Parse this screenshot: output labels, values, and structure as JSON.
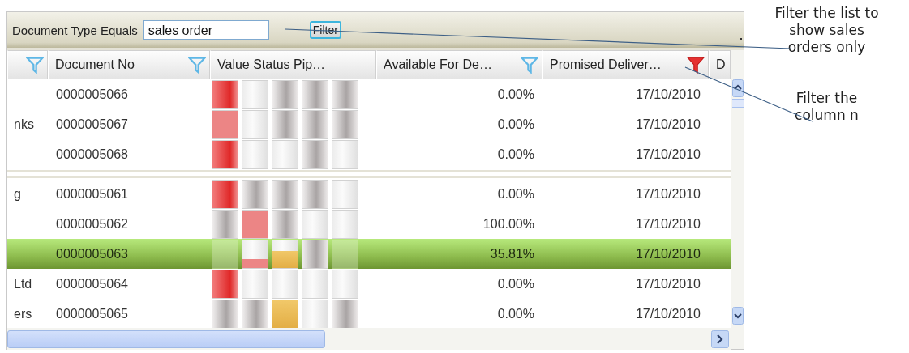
{
  "toolbar": {
    "label": "Document Type Equals",
    "field_value": "sales order",
    "button": "Filter"
  },
  "columns": [
    {
      "has_filter": true,
      "filter_active": false
    },
    {
      "label": "Document No",
      "has_filter": true,
      "filter_active": false
    },
    {
      "label": "Value Status Pip…",
      "has_filter": false
    },
    {
      "label": "Available For De…",
      "has_filter": true,
      "filter_active": false
    },
    {
      "label": "Promised Deliver…",
      "has_filter": true,
      "filter_active": true
    },
    {
      "label": "D",
      "has_filter": false
    }
  ],
  "groups": [
    {
      "rows": [
        {
          "column_1": "",
          "doc": "0000005066",
          "available": "0.00%",
          "promised": "17/10/2010",
          "selected": false,
          "stages": [
            {
              "kind": "red"
            },
            {
              "kind": "light"
            },
            {
              "kind": "dark"
            },
            {
              "kind": "dark"
            },
            {
              "kind": "dark"
            }
          ]
        },
        {
          "column_1": "nks",
          "doc": "0000005067",
          "available": "0.00%",
          "promised": "17/10/2010",
          "selected": false,
          "stages": [
            {
              "kind": "pink"
            },
            {
              "kind": "light"
            },
            {
              "kind": "dark"
            },
            {
              "kind": "dark"
            },
            {
              "kind": "dark"
            }
          ]
        },
        {
          "column_1": "",
          "doc": "0000005068",
          "available": "0.00%",
          "promised": "17/10/2010",
          "selected": false,
          "stages": [
            {
              "kind": "red"
            },
            {
              "kind": "light"
            },
            {
              "kind": "light"
            },
            {
              "kind": "dark"
            },
            {
              "kind": "light"
            }
          ]
        }
      ]
    },
    {
      "rows": [
        {
          "column_1": "g",
          "doc": "0000005061",
          "available": "0.00%",
          "promised": "17/10/2010",
          "selected": false,
          "stages": [
            {
              "kind": "red"
            },
            {
              "kind": "dark"
            },
            {
              "kind": "dark"
            },
            {
              "kind": "dark"
            },
            {
              "kind": "light"
            }
          ]
        },
        {
          "column_1": "",
          "doc": "0000005062",
          "available": "100.00%",
          "promised": "17/10/2010",
          "selected": false,
          "stages": [
            {
              "kind": "dark"
            },
            {
              "kind": "pink"
            },
            {
              "kind": "dark"
            },
            {
              "kind": "light"
            },
            {
              "kind": "light"
            }
          ]
        },
        {
          "column_1": "",
          "doc": "0000005063",
          "available": "35.81%",
          "promised": "17/10/2010",
          "selected": true,
          "stages": [
            {
              "kind": "clear"
            },
            {
              "kind": "pink",
              "level": 0.3
            },
            {
              "kind": "amber",
              "level": 0.6
            },
            {
              "kind": "dark"
            },
            {
              "kind": "clear"
            }
          ]
        },
        {
          "column_1": "Ltd",
          "doc": "0000005064",
          "available": "0.00%",
          "promised": "17/10/2010",
          "selected": false,
          "stages": [
            {
              "kind": "red"
            },
            {
              "kind": "light"
            },
            {
              "kind": "light"
            },
            {
              "kind": "light"
            },
            {
              "kind": "light"
            }
          ]
        },
        {
          "column_1": "ers",
          "doc": "0000005065",
          "available": "0.00%",
          "promised": "17/10/2010",
          "selected": false,
          "stages": [
            {
              "kind": "dark"
            },
            {
              "kind": "dark"
            },
            {
              "kind": "amber"
            },
            {
              "kind": "light"
            },
            {
              "kind": "dark"
            }
          ]
        }
      ]
    }
  ],
  "callouts": [
    {
      "text": "Filter the list to show sales orders only"
    },
    {
      "text": "Filter the column n"
    }
  ]
}
